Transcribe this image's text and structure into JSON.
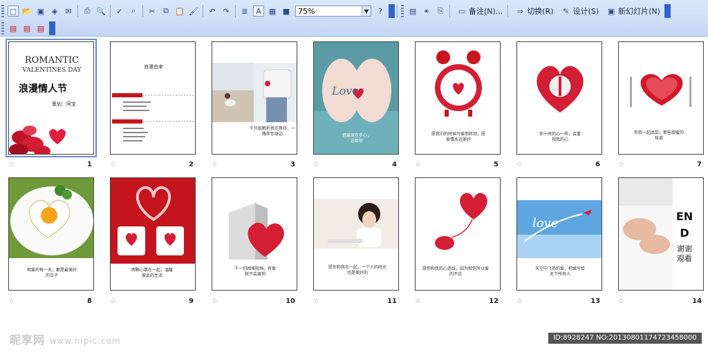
{
  "toolbar": {
    "zoom_value": "75%",
    "notes_label": "备注(N)...",
    "transition_label": "切换(R)",
    "design_label": "设计(S)",
    "new_slide_label": "新幻灯片(N)"
  },
  "slides": [
    {
      "num": "1",
      "title_en": "ROMANTIC",
      "subtitle_en": "VALENTINES DAY",
      "title_zh": "浪漫情人节",
      "author": "策划：阿宝"
    },
    {
      "num": "2",
      "title": "浪漫由来"
    },
    {
      "num": "3",
      "text": "千只纸鹤折我在等待，一路伴你身边"
    },
    {
      "num": "4",
      "text": "把爱放在手心，送给你",
      "logo": "Love"
    },
    {
      "num": "5",
      "text": "愿我们的时钟为爱而转动，愿爱情永远美好"
    },
    {
      "num": "6",
      "text": "你十时的心一样，会重视我的心"
    },
    {
      "num": "7",
      "text": "你我一起品尝，那些甜蜜的味道"
    },
    {
      "num": "8",
      "text": "相爱的每一天，都是最美好的日子"
    },
    {
      "num": "9",
      "text": "两颗心靠在一起，温暖彼此的生活"
    },
    {
      "num": "10",
      "text": "千一切困难阻挡，有爱就不会害怕"
    },
    {
      "num": "11",
      "text": "愿你和我在一起，一个人的时光也是美好的"
    },
    {
      "num": "12",
      "text": "愿你和我的心连线，因为相信所以爱的不远"
    },
    {
      "num": "13",
      "text": "天空中飞扬的爱，把爱写给天下所有人",
      "logo": "love"
    },
    {
      "num": "14",
      "end_text": "END",
      "thanks": "谢谢观看"
    }
  ],
  "watermark": {
    "text": "昵享网",
    "url": "www.nipic.com"
  },
  "status_bar": "ID:8928247 NO:20130801174723458000",
  "colors": {
    "accent": "#d8141e",
    "toolbar": "#c8d9f4"
  }
}
